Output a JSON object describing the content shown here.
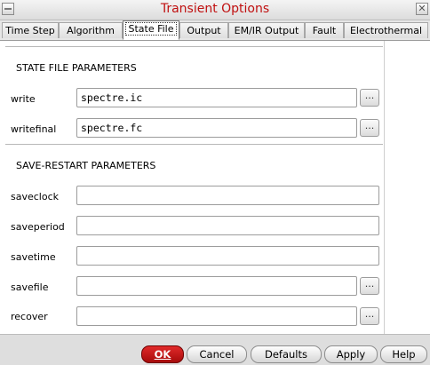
{
  "window": {
    "title": "Transient Options",
    "close_symbol": "✕"
  },
  "tabs": [
    {
      "label": "Time Step"
    },
    {
      "label": "Algorithm"
    },
    {
      "label": "State File",
      "active": true
    },
    {
      "label": "Output"
    },
    {
      "label": "EM/IR Output"
    },
    {
      "label": "Fault"
    },
    {
      "label": "Electrothermal"
    }
  ],
  "state_file": {
    "heading": "STATE FILE PARAMETERS",
    "fields": [
      {
        "label": "write",
        "value": "spectre.ic",
        "browse": "..."
      },
      {
        "label": "writefinal",
        "value": "spectre.fc",
        "browse": "..."
      }
    ]
  },
  "save_restart": {
    "heading": "SAVE-RESTART PARAMETERS",
    "fields": [
      {
        "label": "saveclock",
        "value": ""
      },
      {
        "label": "saveperiod",
        "value": ""
      },
      {
        "label": "savetime",
        "value": ""
      },
      {
        "label": "savefile",
        "value": "",
        "browse": "..."
      },
      {
        "label": "recover",
        "value": "",
        "browse": "..."
      }
    ]
  },
  "buttons": {
    "ok": "OK",
    "cancel": "Cancel",
    "defaults": "Defaults",
    "apply": "Apply",
    "help": "Help"
  },
  "colors": {
    "title": "#c01010",
    "ok_button": "#c81a1a"
  }
}
